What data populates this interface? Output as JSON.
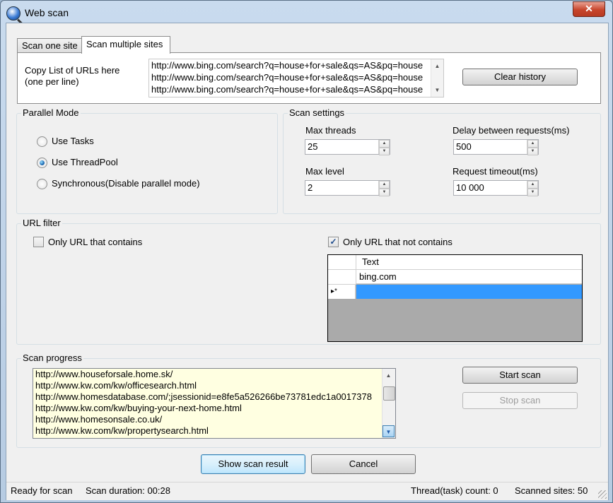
{
  "window": {
    "title": "Web scan",
    "close_glyph": "✕"
  },
  "tabs": [
    {
      "label": "Scan one site",
      "active": false
    },
    {
      "label": "Scan multiple sites",
      "active": true
    }
  ],
  "multi_tab": {
    "copy_label_line1": "Copy List of URLs here",
    "copy_label_line2": "(one per line)",
    "urls": [
      "http://www.bing.com/search?q=house+for+sale&qs=AS&pq=house",
      "http://www.bing.com/search?q=house+for+sale&qs=AS&pq=house",
      "http://www.bing.com/search?q=house+for+sale&qs=AS&pq=house"
    ],
    "clear_history_label": "Clear history"
  },
  "parallel_mode": {
    "title": "Parallel Mode",
    "options": [
      {
        "label": "Use Tasks",
        "checked": false
      },
      {
        "label": "Use ThreadPool",
        "checked": true
      },
      {
        "label": "Synchronous(Disable parallel mode)",
        "checked": false
      }
    ]
  },
  "scan_settings": {
    "title": "Scan settings",
    "max_threads_label": "Max threads",
    "max_threads": "25",
    "delay_label": "Delay between requests(ms)",
    "delay": "500",
    "max_level_label": "Max level",
    "max_level": "2",
    "timeout_label": "Request timeout(ms)",
    "timeout": "10 000"
  },
  "url_filter": {
    "title": "URL filter",
    "contains_label": "Only URL that contains",
    "contains_checked": false,
    "not_contains_label": "Only URL that not contains",
    "not_contains_checked": true,
    "grid_header": "Text",
    "grid_rows": [
      "bing.com"
    ],
    "new_row_marker": "▸*"
  },
  "scan_progress": {
    "title": "Scan progress",
    "lines": [
      "http://www.houseforsale.home.sk/",
      "http://www.kw.com/kw/officesearch.html",
      "http://www.homesdatabase.com/;jsessionid=e8fe5a526266be73781edc1a0017378",
      "http://www.kw.com/kw/buying-your-next-home.html",
      "http://www.homesonsale.co.uk/",
      "http://www.kw.com/kw/propertysearch.html"
    ],
    "start_label": "Start scan",
    "stop_label": "Stop scan"
  },
  "actions": {
    "show_result_label": "Show scan result",
    "cancel_label": "Cancel"
  },
  "status": {
    "ready": "Ready for scan",
    "duration": "Scan duration: 00:28",
    "thread_count": "Thread(task) count: 0",
    "scanned": "Scanned sites: 50"
  },
  "colors": {
    "selection": "#3399ff",
    "progress_bg": "#ffffe1",
    "grid_bg": "#aaaaaa"
  },
  "icons": [
    "app-globe-icon",
    "close-icon",
    "scroll-up-icon",
    "scroll-down-icon",
    "spin-up-icon",
    "spin-down-icon",
    "check-icon",
    "size-grip-icon"
  ]
}
